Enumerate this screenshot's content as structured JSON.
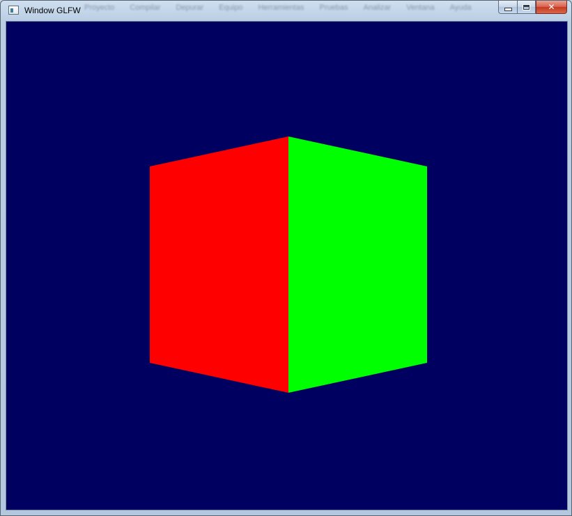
{
  "window": {
    "title": "Window GLFW",
    "icon": "app-window-icon",
    "buttons": {
      "minimize": "minimize-icon",
      "maximize": "maximize-icon",
      "close": "close-icon",
      "close_glyph": "✕"
    }
  },
  "background_menu": {
    "items": [
      "Proyecto",
      "Compilar",
      "Depurar",
      "Equipo",
      "Herramientas",
      "Pruebas",
      "Analizar",
      "Ventana",
      "Ayuda"
    ]
  },
  "viewport": {
    "clear_color": "#000060",
    "cube": {
      "faces": [
        {
          "name": "left-face",
          "color": "#ff0000"
        },
        {
          "name": "right-face",
          "color": "#00ff00"
        }
      ]
    }
  }
}
